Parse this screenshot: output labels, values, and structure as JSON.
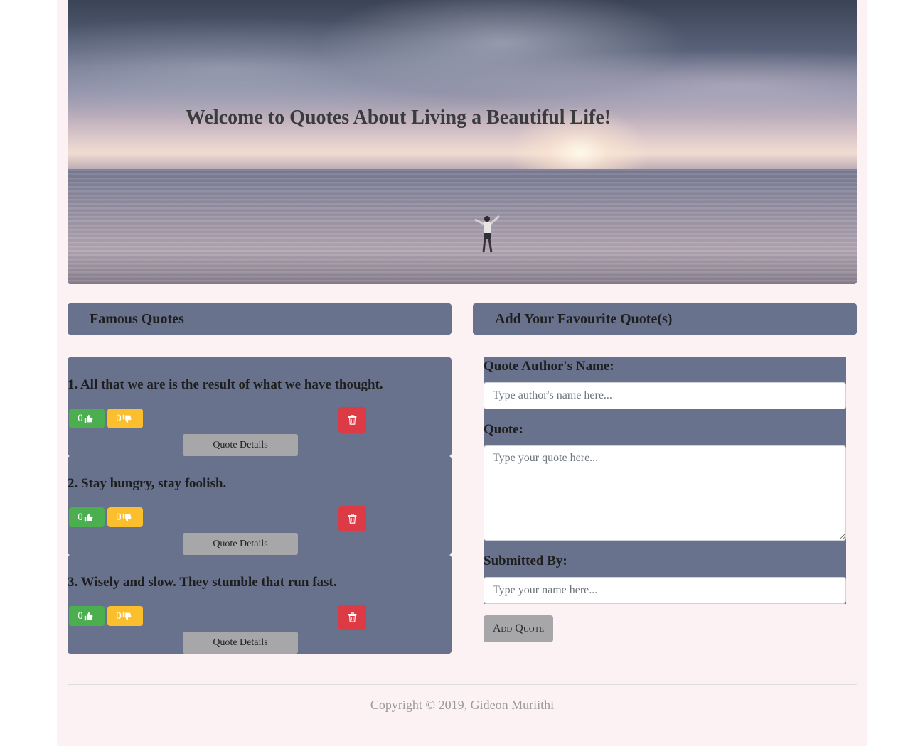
{
  "hero": {
    "title": "Welcome to Quotes About Living a Beautiful Life!"
  },
  "left_section": {
    "header": "Famous Quotes"
  },
  "right_section": {
    "header": "Add Your Favourite Quote(s)"
  },
  "quotes": [
    {
      "text": "1. All that we are is the result of what we have thought.",
      "likes": "0",
      "dislikes": "0",
      "details_label": "Quote Details"
    },
    {
      "text": "2. Stay hungry, stay foolish.",
      "likes": "0",
      "dislikes": "0",
      "details_label": "Quote Details"
    },
    {
      "text": "3. Wisely and slow. They stumble that run fast.",
      "likes": "0",
      "dislikes": "0",
      "details_label": "Quote Details"
    }
  ],
  "form": {
    "author_label": "Quote Author's Name:",
    "author_placeholder": "Type author's name here...",
    "quote_label": "Quote:",
    "quote_placeholder": "Type your quote here...",
    "submitted_label": "Submitted By:",
    "submitted_placeholder": "Type your name here...",
    "submit_label": "Add Quote"
  },
  "footer": {
    "copyright": "Copyright © 2019, Gideon Muriithi"
  },
  "colors": {
    "panel": "#68728c",
    "like": "#4bae4f",
    "dislike": "#fbbf2d",
    "delete": "#dc3a45",
    "page_bg": "#fcf2f3"
  },
  "icons": {
    "like": "thumbs-up-icon",
    "dislike": "thumbs-down-icon",
    "delete": "trash-icon"
  }
}
